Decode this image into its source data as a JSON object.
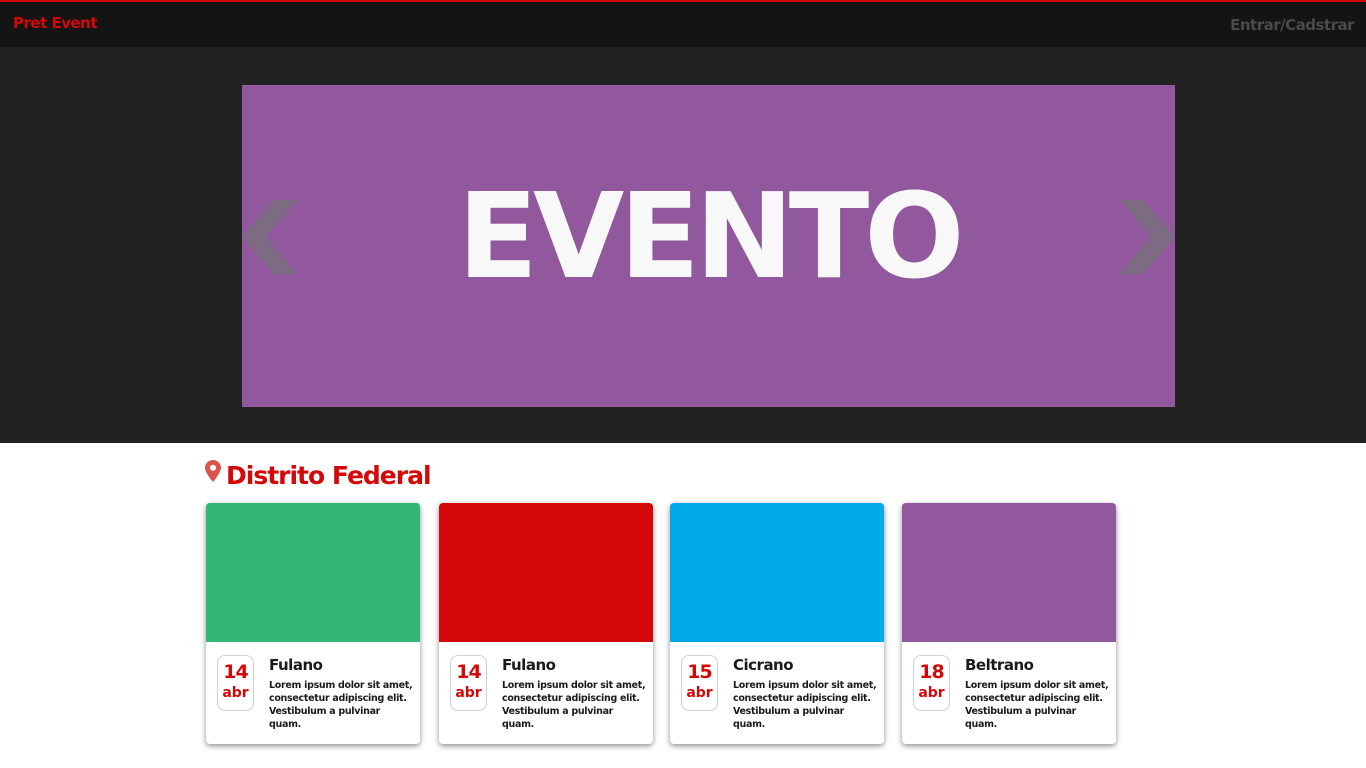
{
  "nav": {
    "brand": "Pret Event",
    "login": "Entrar/Cadstrar",
    "brand_color": "#d40808"
  },
  "hero": {
    "slide_title": "EVENTO",
    "slide_color": "#91589e",
    "prev_icon": "chevron-left-icon",
    "next_icon": "chevron-right-icon"
  },
  "section": {
    "icon": "map-pin-icon",
    "title": "Distrito Federal"
  },
  "cards": [
    {
      "image_color": "#33b775",
      "day": "14",
      "month": "abr",
      "title": "Fulano",
      "description": "Lorem ipsum dolor sit amet, consectetur adipiscing elit. Vestibulum a pulvinar quam."
    },
    {
      "image_color": "#d40808",
      "day": "14",
      "month": "abr",
      "title": "Fulano",
      "description": "Lorem ipsum dolor sit amet, consectetur adipiscing elit. Vestibulum a pulvinar quam."
    },
    {
      "image_color": "#00aaea",
      "day": "15",
      "month": "abr",
      "title": "Cicrano",
      "description": "Lorem ipsum dolor sit amet, consectetur adipiscing elit. Vestibulum a pulvinar quam."
    },
    {
      "image_color": "#91589e",
      "day": "18",
      "month": "abr",
      "title": "Beltrano",
      "description": "Lorem ipsum dolor sit amet, consectetur adipiscing elit. Vestibulum a pulvinar quam."
    }
  ]
}
